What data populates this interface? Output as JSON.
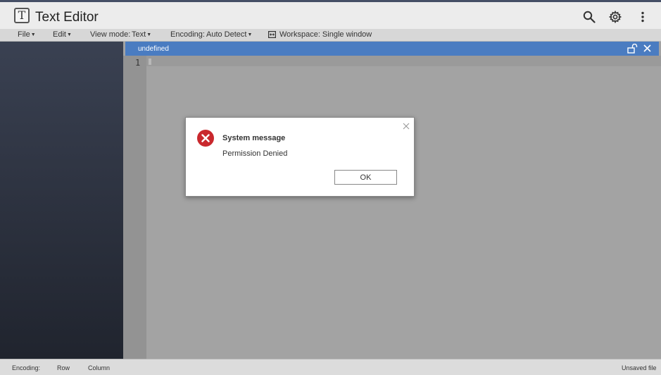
{
  "window": {
    "title": "Text Editor",
    "logo_letter": "T"
  },
  "toolbar_icons": {
    "search": "search-icon",
    "settings": "gear-icon",
    "more": "more-vertical-icon"
  },
  "menu": {
    "file": "File",
    "edit": "Edit",
    "view_mode_label": "View mode:",
    "view_mode_value": "Text",
    "encoding_label": "Encoding:",
    "encoding_value": "Auto Detect",
    "workspace": "Workspace: Single window"
  },
  "editor": {
    "tab_name": "undefined",
    "line_numbers": [
      "1"
    ]
  },
  "status": {
    "encoding": "Encoding:",
    "row": "Row",
    "column": "Column",
    "file_state": "Unsaved file"
  },
  "dialog": {
    "title": "System message",
    "message": "Permission Denied",
    "ok_label": "OK"
  },
  "colors": {
    "accent": "#4a7cc1",
    "error": "#c9282d",
    "sidebar_top": "#3a4152",
    "sidebar_bottom": "#20242e"
  }
}
